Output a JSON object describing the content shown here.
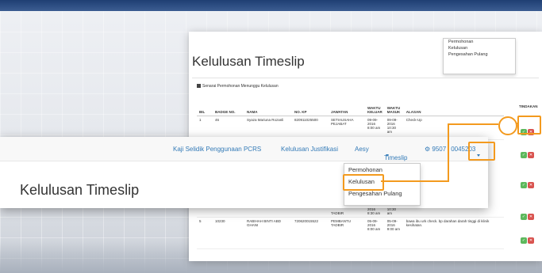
{
  "background_screenshot": {
    "page_title": "Kelulusan Timeslip",
    "dropdown_items": [
      "Permohonan",
      "Kelulusan",
      "Pengesahan Pulang"
    ],
    "panel_heading": "Senarai Permohonan Menunggu Kelulusan",
    "table": {
      "headers": [
        "BIL",
        "BADGE NO.",
        "NAMA",
        "NO. KP",
        "JAWATAN",
        "WAKTU KELUAR",
        "WAKTU MASUK",
        "ALASAN"
      ],
      "action_header": "TINDAKAN",
      "rows": [
        {
          "bil": "1",
          "badge": "46",
          "nama": "Syaza Mariuna Rozanli",
          "kp": "820911025500",
          "jawatan": "SETIAUSAHA PEJABAT",
          "keluar": "09-09-2016 8:00 am",
          "masuk": "09-09-2016 10:30 am",
          "alasan": "Check-Up"
        },
        {
          "bil": "",
          "badge": "",
          "nama": "",
          "kp": "",
          "jawatan": "TADBIR",
          "keluar": "2016 8:30 am",
          "masuk": "2016 10:30 am",
          "alasan": ""
        },
        {
          "bil": "5",
          "badge": "10230",
          "nama": "RABIHAH BINTI ABD GHANI",
          "kp": "720620015522",
          "jawatan": "PEMBANTU TADBIR",
          "keluar": "05-09-2016 8:00 am",
          "masuk": "05-09-2016 9:00 am",
          "alasan": "bawa ibu urk check. bp darahan darah tinggi di klinik kesihatan."
        }
      ],
      "ok_symbol": "✓",
      "reject_symbol": "✕"
    }
  },
  "foreground_screenshot": {
    "nav": {
      "item1": "Kaji Selidik Penggunaan PCRS",
      "item2": "Kelulusan Justifikasi",
      "item3": "Aesy",
      "item4": "Timeslip",
      "user": "9507",
      "user_suffix": "0045203",
      "user_icon": "gear-icon"
    },
    "page_title": "Kelulusan Timeslip",
    "dropdown_items": [
      "Permohonan",
      "Kelulusan",
      "Pengesahan Pulang"
    ],
    "highlighted_item": "Kelulusan"
  },
  "colors": {
    "accent_highlight": "#f39a1e",
    "link": "#337ab7",
    "approve": "#5cb85c",
    "reject": "#d9534f",
    "top_band": "#1f3f73"
  }
}
